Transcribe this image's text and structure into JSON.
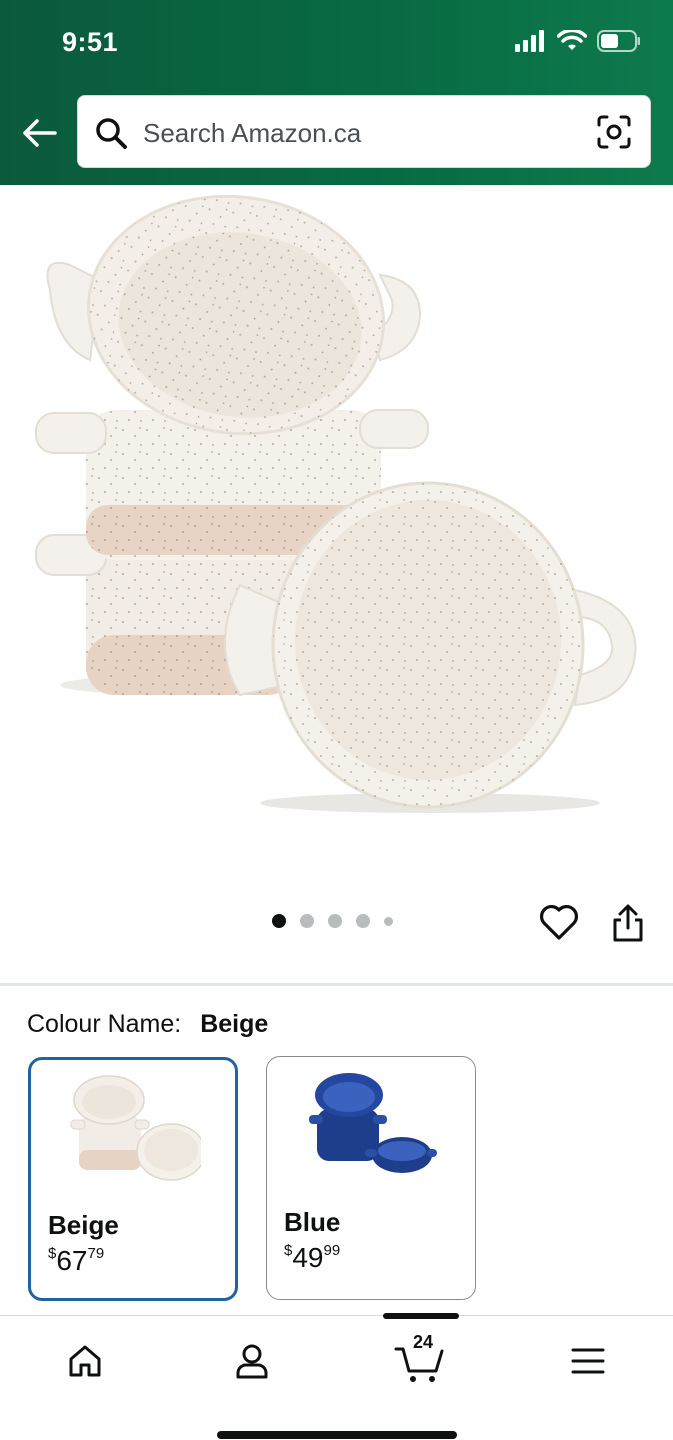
{
  "status_bar": {
    "time": "9:51"
  },
  "search": {
    "placeholder": "Search Amazon.ca"
  },
  "image_carousel": {
    "total_images": 5,
    "active_index": 0
  },
  "colour": {
    "label": "Colour Name:",
    "selected": "Beige",
    "options": [
      {
        "name": "Beige",
        "symbol": "$",
        "dollars": "67",
        "cents": "79",
        "selected": true
      },
      {
        "name": "Blue",
        "symbol": "$",
        "dollars": "49",
        "cents": "99",
        "selected": false
      }
    ]
  },
  "bottom_nav": {
    "items": [
      "home-icon",
      "account-icon",
      "cart-icon",
      "menu-icon"
    ],
    "cart_count": "24",
    "active": "cart"
  },
  "colors": {
    "header_green": "#086a42",
    "selected_border": "#2162a1",
    "text": "#0f1111"
  }
}
